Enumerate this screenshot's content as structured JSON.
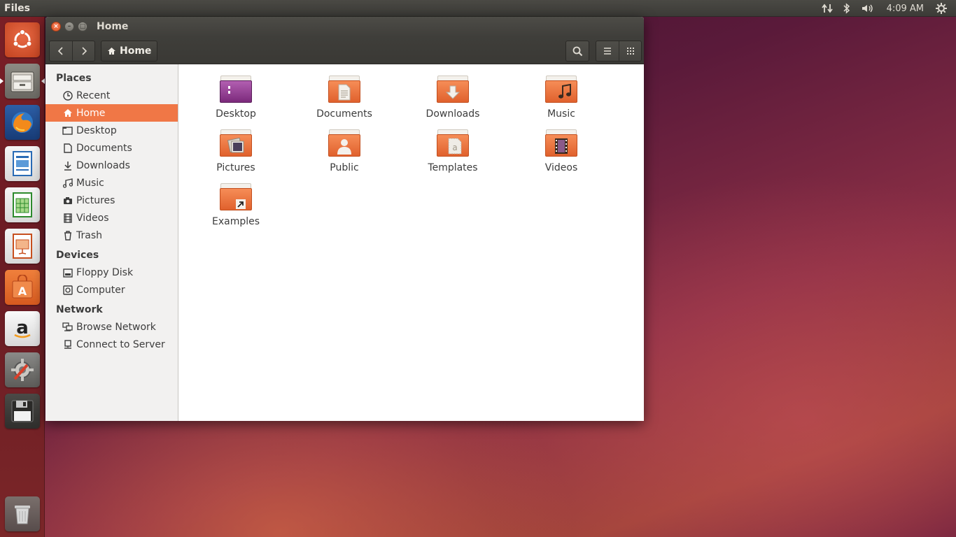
{
  "top_panel": {
    "app_name": "Files",
    "clock": "4:09 AM",
    "icons": [
      "network-transfer-icon",
      "bluetooth-icon",
      "volume-icon",
      "settings-gear-icon"
    ]
  },
  "launcher": {
    "items": [
      {
        "name": "ubuntu-dash-icon",
        "label": "Search your computer"
      },
      {
        "name": "files-app-icon",
        "label": "Files"
      },
      {
        "name": "firefox-icon",
        "label": "Firefox Web Browser"
      },
      {
        "name": "writer-icon",
        "label": "LibreOffice Writer"
      },
      {
        "name": "calc-icon",
        "label": "LibreOffice Calc"
      },
      {
        "name": "impress-icon",
        "label": "LibreOffice Impress"
      },
      {
        "name": "software-center-icon",
        "label": "Ubuntu Software Center"
      },
      {
        "name": "amazon-icon",
        "label": "Amazon"
      },
      {
        "name": "system-settings-icon",
        "label": "System Settings"
      },
      {
        "name": "floppy-icon",
        "label": "Floppy Disk"
      },
      {
        "name": "trash-icon",
        "label": "Trash"
      }
    ]
  },
  "window": {
    "title": "Home",
    "path_label": "Home",
    "controls": {
      "close": "×",
      "minimize": "–",
      "maximize": "□"
    }
  },
  "sidebar": {
    "places_heading": "Places",
    "places": [
      {
        "label": "Recent",
        "icon": "clock-icon"
      },
      {
        "label": "Home",
        "icon": "home-icon",
        "active": true
      },
      {
        "label": "Desktop",
        "icon": "desktop-folder-icon"
      },
      {
        "label": "Documents",
        "icon": "document-icon"
      },
      {
        "label": "Downloads",
        "icon": "download-icon"
      },
      {
        "label": "Music",
        "icon": "music-icon"
      },
      {
        "label": "Pictures",
        "icon": "camera-icon"
      },
      {
        "label": "Videos",
        "icon": "film-icon"
      },
      {
        "label": "Trash",
        "icon": "trash-icon"
      }
    ],
    "devices_heading": "Devices",
    "devices": [
      {
        "label": "Floppy Disk",
        "icon": "floppy-drive-icon"
      },
      {
        "label": "Computer",
        "icon": "harddisk-icon"
      }
    ],
    "network_heading": "Network",
    "network": [
      {
        "label": "Browse Network",
        "icon": "network-icon"
      },
      {
        "label": "Connect to Server",
        "icon": "server-icon"
      }
    ]
  },
  "files": [
    {
      "label": "Desktop",
      "emblem": "desktop"
    },
    {
      "label": "Documents",
      "emblem": "documents"
    },
    {
      "label": "Downloads",
      "emblem": "downloads"
    },
    {
      "label": "Music",
      "emblem": "music"
    },
    {
      "label": "Pictures",
      "emblem": "pictures"
    },
    {
      "label": "Public",
      "emblem": "public"
    },
    {
      "label": "Templates",
      "emblem": "templates"
    },
    {
      "label": "Videos",
      "emblem": "videos"
    },
    {
      "label": "Examples",
      "emblem": "link"
    }
  ],
  "colors": {
    "accent": "#f07746",
    "panel": "#3c3b37",
    "launcher": "#6a1c24"
  }
}
